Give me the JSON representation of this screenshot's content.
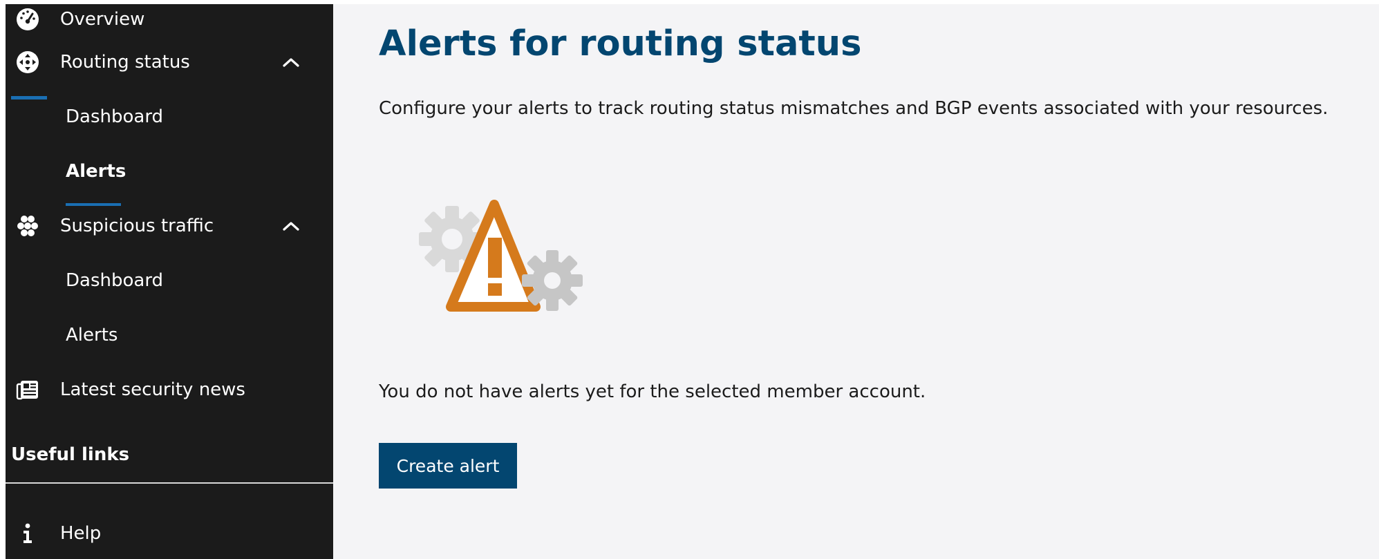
{
  "sidebar": {
    "overview": {
      "label": "Overview"
    },
    "routing": {
      "label": "Routing status",
      "children": [
        {
          "label": "Dashboard"
        },
        {
          "label": "Alerts"
        }
      ]
    },
    "suspicious": {
      "label": "Suspicious traffic",
      "children": [
        {
          "label": "Dashboard"
        },
        {
          "label": "Alerts"
        }
      ]
    },
    "news": {
      "label": "Latest security news"
    },
    "useful_links": {
      "heading": "Useful links"
    },
    "help": {
      "label": "Help"
    }
  },
  "main": {
    "title": "Alerts for routing status",
    "description": "Configure your alerts to track routing status mismatches and BGP events associated with your resources.",
    "empty_message": "You do not have alerts yet for the selected member account.",
    "create_button": "Create alert"
  },
  "colors": {
    "sidebar_bg": "#1b1b1b",
    "accent": "#1a6fb3",
    "title": "#034670",
    "button_bg": "#034670",
    "warning": "#d57a1c",
    "gear": "#cccccc",
    "content_bg": "#f4f4f6"
  }
}
